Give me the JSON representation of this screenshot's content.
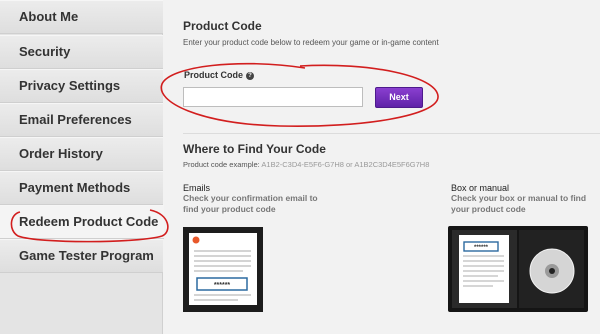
{
  "sidebar": {
    "items": [
      {
        "label": "About Me"
      },
      {
        "label": "Security"
      },
      {
        "label": "Privacy Settings"
      },
      {
        "label": "Email Preferences"
      },
      {
        "label": "Order History"
      },
      {
        "label": "Payment Methods"
      },
      {
        "label": "Redeem Product Code"
      },
      {
        "label": "Game Tester Program"
      }
    ],
    "active_index": 6
  },
  "product_code": {
    "title": "Product Code",
    "subtitle": "Enter your product code below to redeem your game or in-game content",
    "field_label": "Product Code",
    "help_icon_glyph": "?",
    "input_value": "",
    "next_label": "Next"
  },
  "where": {
    "title": "Where to Find Your Code",
    "example_label": "Product code example:",
    "example_value": "A1B2-C3D4-E5F6-G7H8 or A1B2C3D4E5F6G7H8",
    "emails_title": "Emails",
    "emails_desc_line1": "Check your confirmation email to",
    "emails_desc_line2": "find your product code",
    "box_title": "Box or manual",
    "box_desc_line1": "Check your box or manual to find",
    "box_desc_line2": "your product code",
    "code_mask": "******"
  },
  "colors": {
    "accent": "#6a2bbd",
    "annotation": "#d21e1e"
  }
}
